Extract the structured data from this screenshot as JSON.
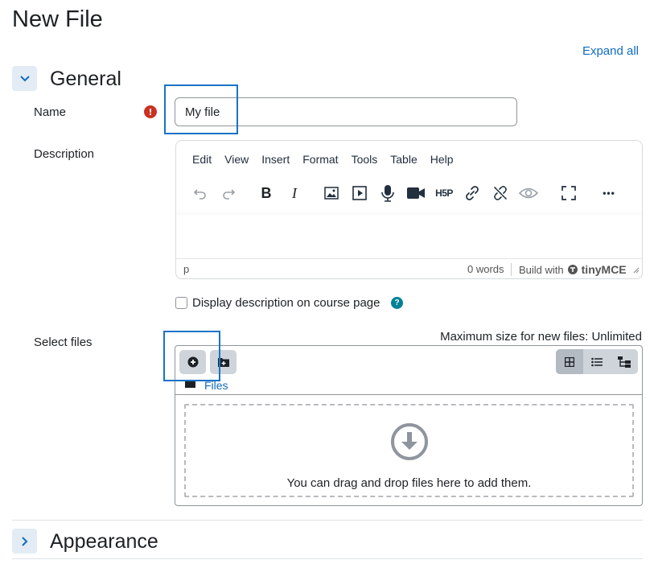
{
  "page": {
    "title": "New File",
    "expand_all": "Expand all"
  },
  "sections": {
    "general": {
      "title": "General",
      "expanded": true
    },
    "appearance": {
      "title": "Appearance",
      "expanded": false
    }
  },
  "name_field": {
    "label": "Name",
    "value": "My file",
    "required_icon": "exclamation-icon"
  },
  "description": {
    "label": "Description",
    "menu": [
      "Edit",
      "View",
      "Insert",
      "Format",
      "Tools",
      "Table",
      "Help"
    ],
    "toolbar_icons": [
      "undo-icon",
      "redo-icon",
      "bold-icon",
      "italic-icon",
      "image-icon",
      "media-icon",
      "microphone-icon",
      "video-camera-icon",
      "h5p-icon",
      "link-icon",
      "unlink-icon",
      "eye-icon",
      "fullscreen-icon",
      "more-icon"
    ],
    "bold_glyph": "B",
    "italic_glyph": "I",
    "h5p_label": "H5P",
    "more_glyph": "•••",
    "status_path": "p",
    "word_count": "0 words",
    "built_with": "Build with",
    "brand": "tinyMCE"
  },
  "display_description": {
    "label": "Display description on course page",
    "checked": false
  },
  "select_files": {
    "label": "Select files",
    "max_size": "Maximum size for new files: Unlimited",
    "breadcrumb": "Files",
    "drop_text": "You can drag and drop files here to add them."
  },
  "colors": {
    "link": "#0f6cbf",
    "required": "#ca3120",
    "help": "#008196",
    "highlight": "#1a73c8"
  }
}
